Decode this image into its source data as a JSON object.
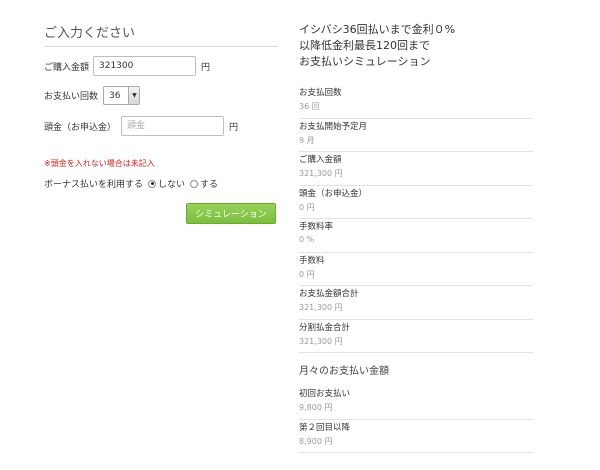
{
  "form": {
    "title": "ご入力ください",
    "price_label": "ご購入金額",
    "price_value": "321300",
    "price_unit": "円",
    "count_label": "お支払い回数",
    "count_value": "36",
    "down_label": "頭金（お申込金）",
    "down_placeholder": "頭金",
    "down_unit": "円",
    "down_note": "※頭金を入れない場合は未記入",
    "bonus_label": "ボーナス払いを利用する",
    "bonus_no": "しない",
    "bonus_yes": "する",
    "bonus_selected": "しない",
    "button": "シミュレーション"
  },
  "result": {
    "title_line1": "イシバシ36回払いまで金利０%",
    "title_line2": "以降低金利最長120回まで",
    "title_line3": "お支払いシミュレーション",
    "items": [
      {
        "label": "お支払回数",
        "value": "36 回"
      },
      {
        "label": "お支払開始予定月",
        "value": "9 月"
      },
      {
        "label": "ご購入金額",
        "value": "321,300 円"
      },
      {
        "label": "頭金（お申込金）",
        "value": "0 円"
      },
      {
        "label": "手数料率",
        "value": "0 %"
      },
      {
        "label": "手数料",
        "value": "0 円"
      },
      {
        "label": "お支払金額合計",
        "value": "321,300 円"
      },
      {
        "label": "分割払金合計",
        "value": "321,300 円"
      }
    ],
    "monthly_title": "月々のお支払い金額",
    "monthly": [
      {
        "label": "初回お支払い",
        "value": "9,800 円"
      },
      {
        "label": "第２回目以降",
        "value": "8,900 円"
      }
    ]
  }
}
